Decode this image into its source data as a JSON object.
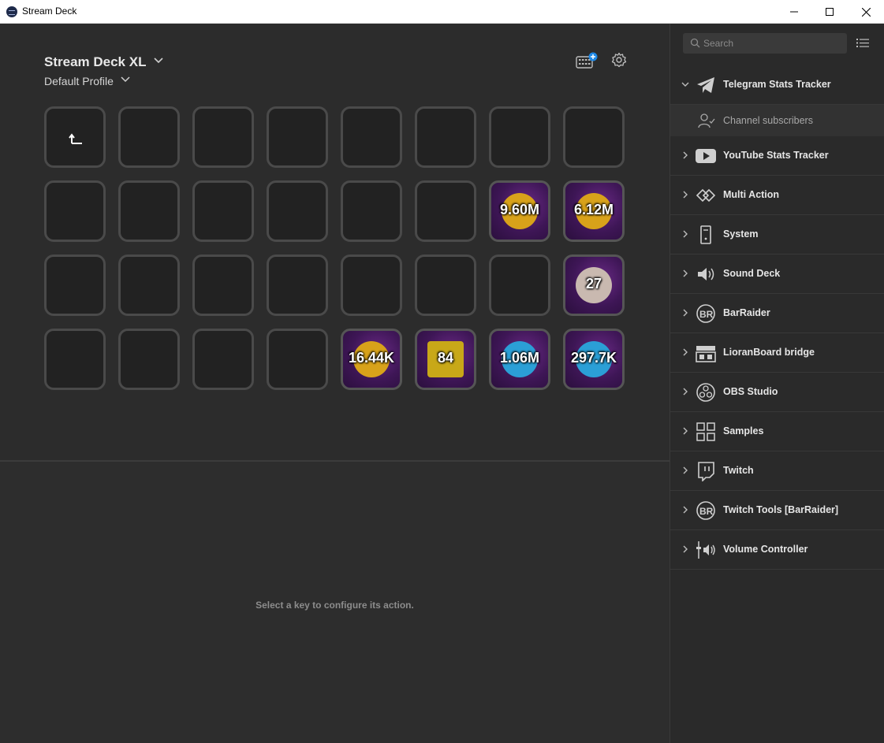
{
  "window": {
    "title": "Stream Deck"
  },
  "header": {
    "device": "Stream Deck XL",
    "profile": "Default Profile"
  },
  "keys": [
    {
      "id": "k-1-1",
      "type": "back"
    },
    {
      "id": "k-2-7",
      "type": "art",
      "label": "9.60M",
      "badge": "#d8a21a"
    },
    {
      "id": "k-2-8",
      "type": "art",
      "label": "6.12M",
      "badge": "#d8a21a"
    },
    {
      "id": "k-3-8",
      "type": "art",
      "label": "27",
      "badge": "#c9b9b0"
    },
    {
      "id": "k-4-5",
      "type": "art",
      "label": "16.44K",
      "badge": "#d8a21a"
    },
    {
      "id": "k-4-6",
      "type": "art",
      "label": "84",
      "badge": "#c8a818"
    },
    {
      "id": "k-4-7",
      "type": "art",
      "label": "1.06M",
      "badge": "#2b9fd6"
    },
    {
      "id": "k-4-8",
      "type": "art",
      "label": "297.7K",
      "badge": "#2b9fd6"
    }
  ],
  "hint": "Select a key to configure its action.",
  "sidebar": {
    "search_placeholder": "Search",
    "categories": [
      {
        "label": "Telegram Stats Tracker",
        "icon": "telegram-icon",
        "expanded": true
      },
      {
        "label": "YouTube Stats Tracker",
        "icon": "youtube-icon"
      },
      {
        "label": "Multi Action",
        "icon": "multi-action-icon"
      },
      {
        "label": "System",
        "icon": "system-icon"
      },
      {
        "label": "Sound Deck",
        "icon": "sound-deck-icon"
      },
      {
        "label": "BarRaider",
        "icon": "barraider-icon"
      },
      {
        "label": "LioranBoard bridge",
        "icon": "lioranboard-icon"
      },
      {
        "label": "OBS Studio",
        "icon": "obs-icon"
      },
      {
        "label": "Samples",
        "icon": "samples-icon"
      },
      {
        "label": "Twitch",
        "icon": "twitch-icon"
      },
      {
        "label": "Twitch Tools [BarRaider]",
        "icon": "barraider-icon"
      },
      {
        "label": "Volume Controller",
        "icon": "volume-icon"
      }
    ],
    "subitem": {
      "label": "Channel subscribers",
      "icon": "user-check-icon"
    }
  },
  "colors": {
    "accent": "#1e88e5",
    "background": "#2d2d2d",
    "key_border": "#4a4a4a"
  }
}
